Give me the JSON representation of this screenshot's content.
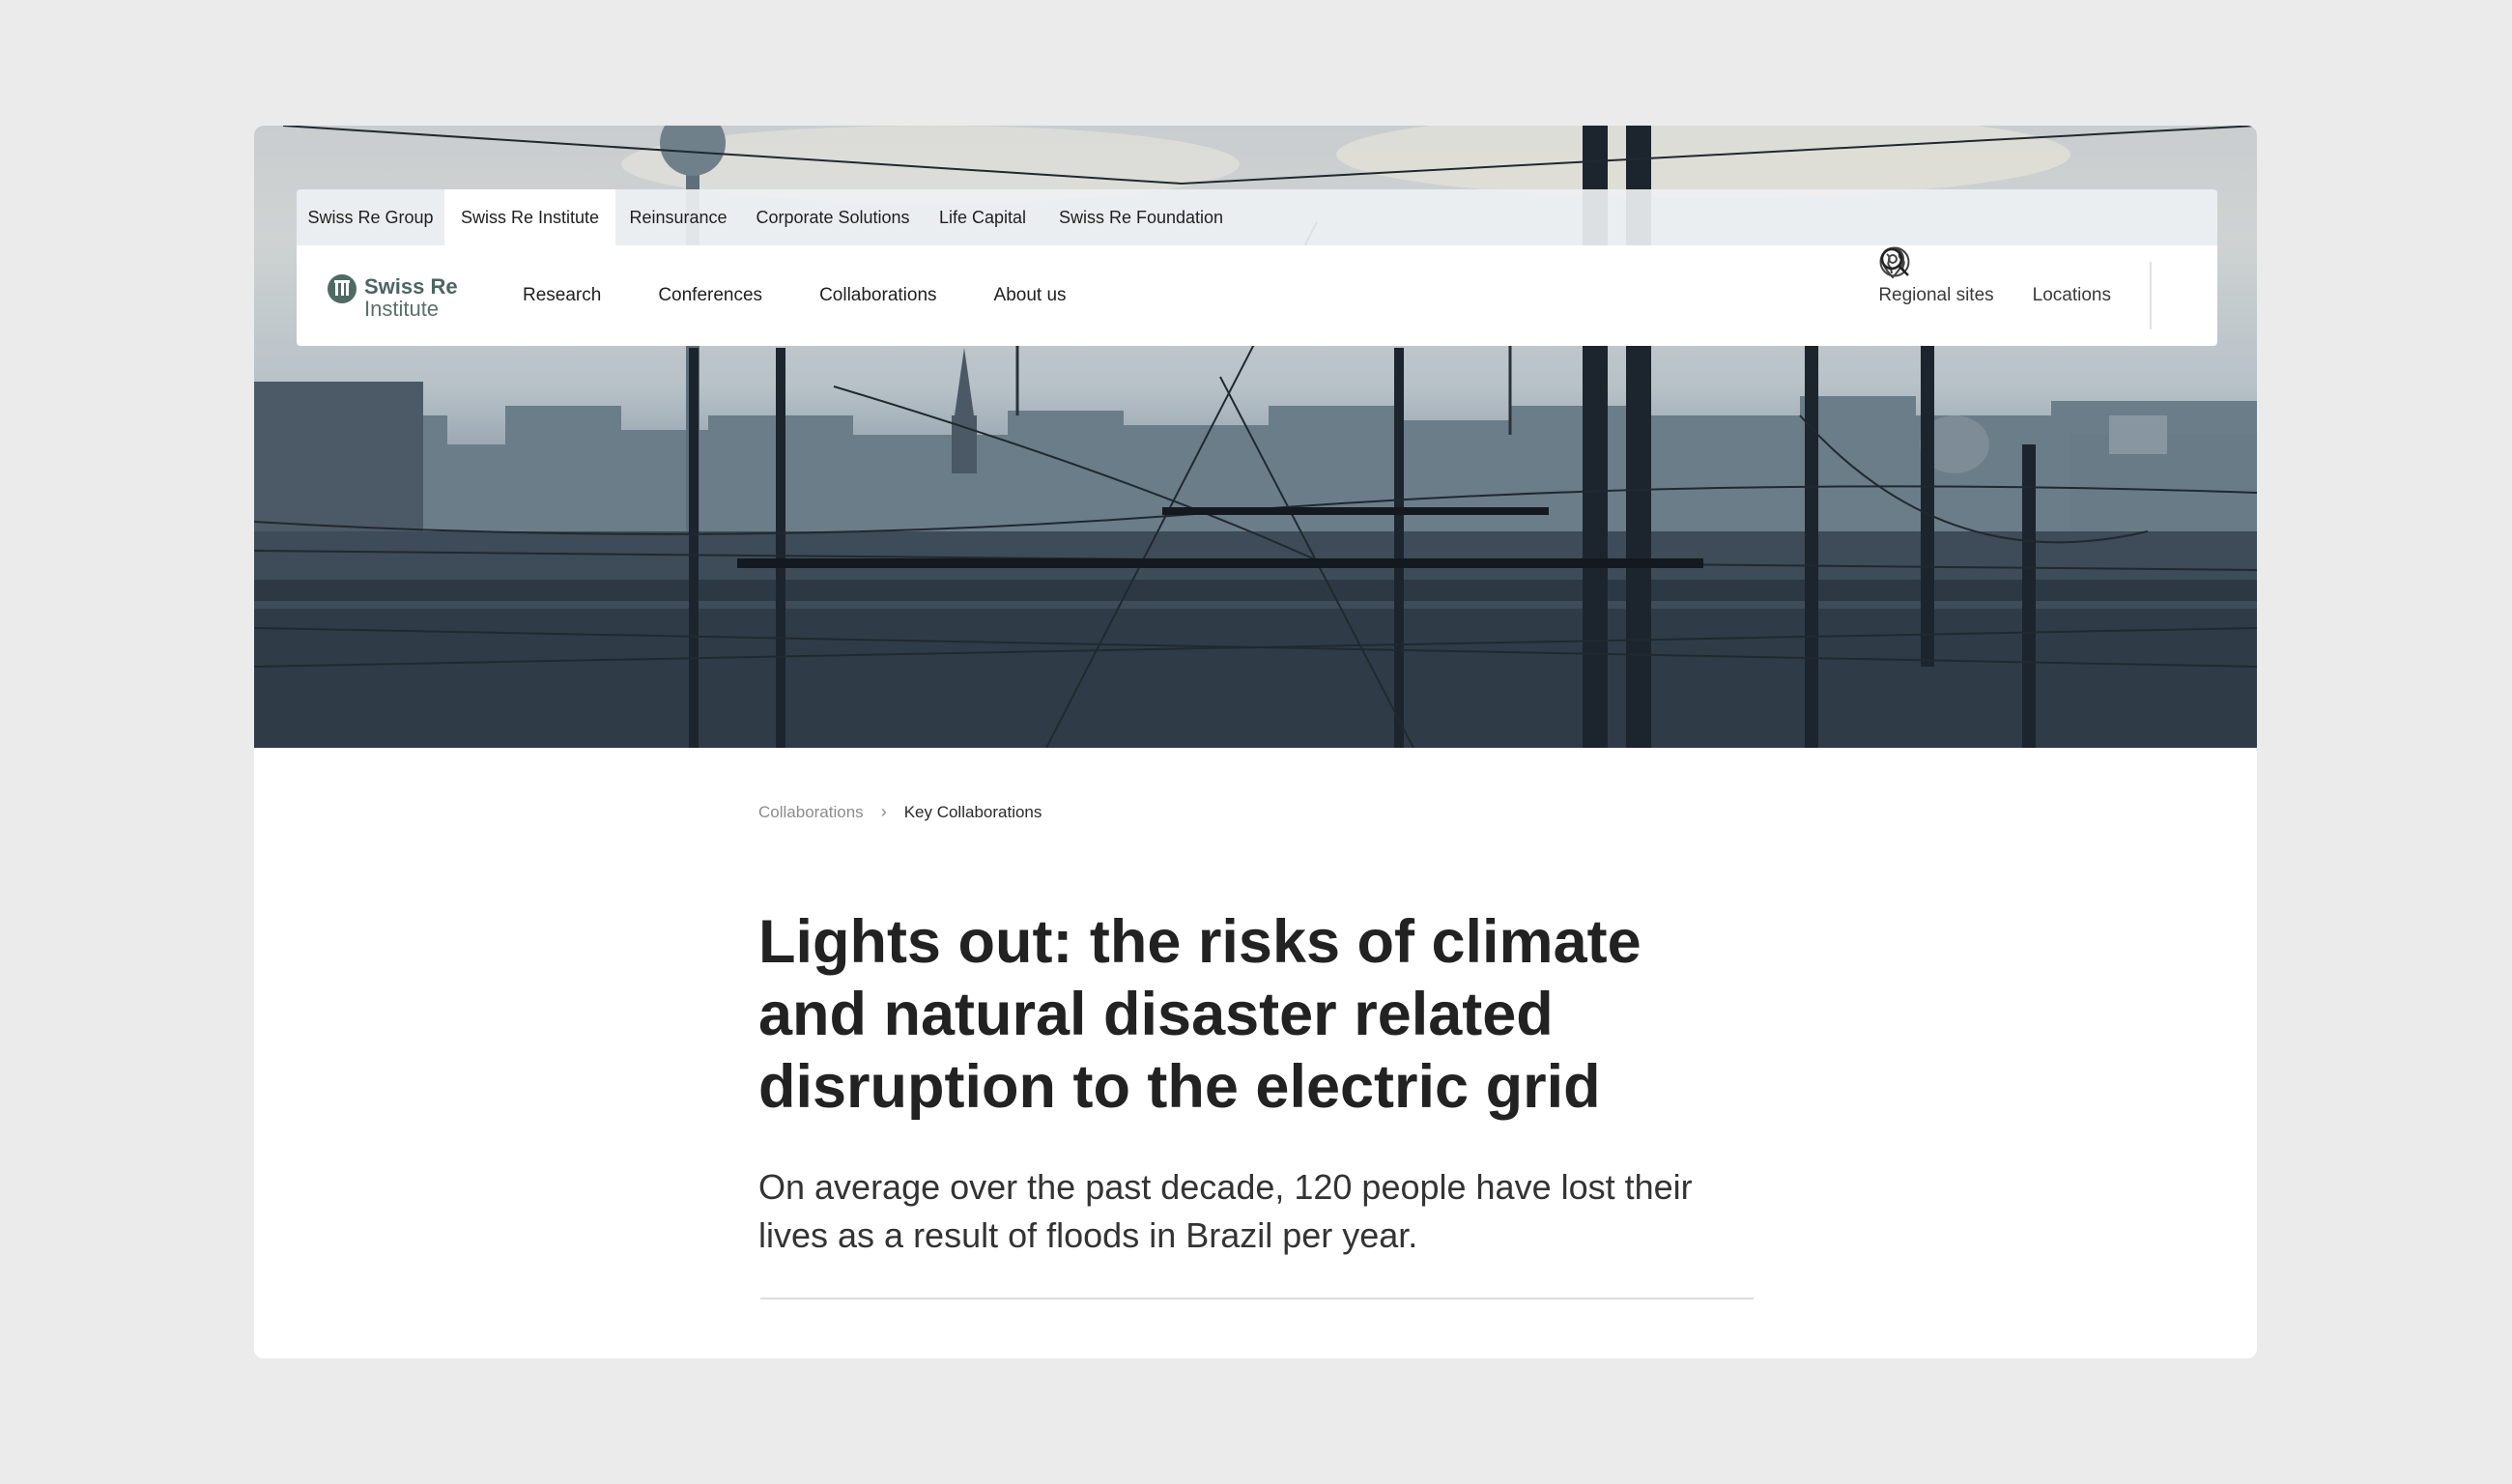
{
  "top_tabs": [
    "Swiss Re Group",
    "Swiss Re Institute",
    "Reinsurance",
    "Corporate Solutions",
    "Life Capital",
    "Swiss Re Foundation"
  ],
  "active_tab": "Swiss Re Institute",
  "logo": {
    "line1": "Swiss Re",
    "line2": "Institute"
  },
  "main_nav": [
    "Research",
    "Conferences",
    "Collaborations",
    "About us"
  ],
  "nav_right": {
    "regional": "Regional sites",
    "locations": "Locations"
  },
  "icons": {
    "regional": "globe-icon",
    "locations": "location-pin-icon",
    "search": "search-icon"
  },
  "breadcrumb": {
    "parent": "Collaborations",
    "current": "Key Collaborations"
  },
  "article": {
    "title": "Lights out: the risks of climate and natural disaster related disruption to the electric grid",
    "lead": "On average over the past decade, 120 people have lost their lives as a result of floods in Brazil per year."
  },
  "colors": {
    "brand": "#4f6a63",
    "background": "#ebebeb"
  }
}
